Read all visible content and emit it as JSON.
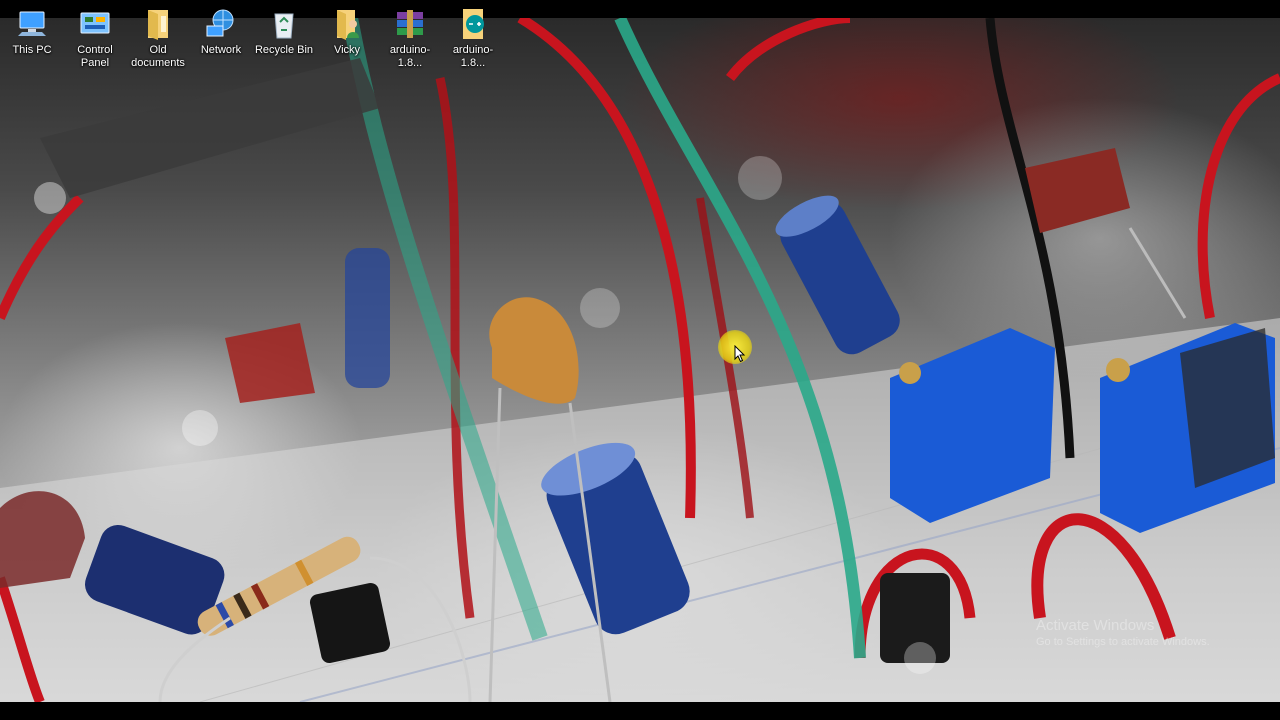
{
  "desktop": {
    "icons": [
      {
        "label": "This PC",
        "icon": "computer-icon"
      },
      {
        "label": "Control Panel",
        "icon": "control-panel-icon"
      },
      {
        "label": "Old documents",
        "icon": "folder-icon"
      },
      {
        "label": "Network",
        "icon": "network-icon"
      },
      {
        "label": "Recycle Bin",
        "icon": "recycle-bin-icon"
      },
      {
        "label": "Vicky",
        "icon": "user-folder-icon"
      },
      {
        "label": "arduino-1.8...",
        "icon": "winrar-archive-icon"
      },
      {
        "label": "arduino-1.8...",
        "icon": "arduino-file-icon"
      }
    ]
  },
  "watermark": {
    "title": "Activate Windows",
    "subtitle": "Go to Settings to activate Windows."
  },
  "colors": {
    "wire_red": "#c8141e",
    "wire_green": "#2aa98a",
    "cap_blue": "#1f3f8f",
    "pot_blue": "#1a5bd6",
    "ceramic": "#c98a3a",
    "cursor_halo": "#f0e030"
  }
}
